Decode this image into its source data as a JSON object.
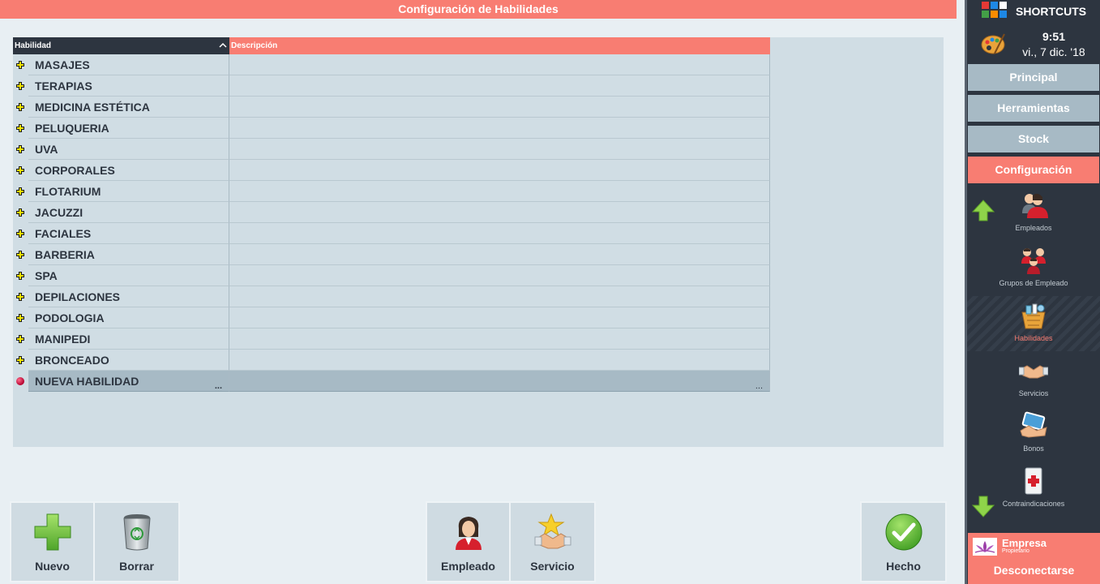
{
  "title": "Configuración de Habilidades",
  "grid": {
    "col_habilidad": "Habilidad",
    "col_descripcion": "Descripción",
    "rows": [
      "MASAJES",
      "TERAPIAS",
      "MEDICINA ESTÉTICA",
      "PELUQUERIA",
      "UVA",
      "CORPORALES",
      "FLOTARIUM",
      "JACUZZI",
      "FACIALES",
      "BARBERIA",
      "SPA",
      "DEPILACIONES",
      "PODOLOGIA",
      "MANIPEDI",
      "BRONCEADO"
    ],
    "new_row": "NUEVA HABILIDAD",
    "ellipsis": "..."
  },
  "buttons": {
    "nuevo": "Nuevo",
    "borrar": "Borrar",
    "empleado": "Empleado",
    "servicio": "Servicio",
    "hecho": "Hecho"
  },
  "sidebar": {
    "shortcuts_title": "SHORTCUTS",
    "time": "9:51",
    "date": "vi., 7 dic. '18",
    "nav": [
      "Principal",
      "Herramientas",
      "Stock",
      "Configuración"
    ],
    "active_nav": "Configuración",
    "items": [
      "Empleados",
      "Grupos de Empleado",
      "Habilidades",
      "Servicios",
      "Bonos",
      "Contraindicaciones"
    ],
    "selected_item": "Habilidades",
    "company_name": "Empresa",
    "company_role": "Propietario",
    "logout": "Desconectarse"
  },
  "colors": {
    "accent": "#f87d72",
    "dark": "#2d3540",
    "row_bg": "#d0dde4",
    "nav_bg": "#a7bac5"
  }
}
